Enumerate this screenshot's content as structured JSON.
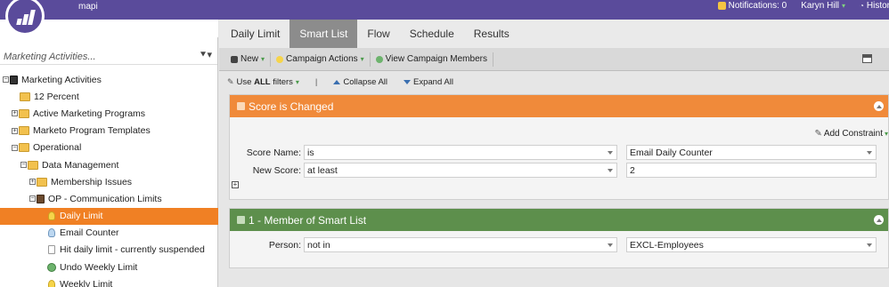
{
  "topbar": {
    "app_name": "mapi",
    "notifications": "Notifications: 0",
    "user": "Karyn Hill",
    "history": "History"
  },
  "sidebar": {
    "search_placeholder": "Marketing Activities...",
    "tree": [
      {
        "label": "Marketing Activities",
        "icon": "page-icon",
        "toggle": "-",
        "indent": 0
      },
      {
        "label": "12 Percent",
        "icon": "folder-icon",
        "toggle": "",
        "indent": 1
      },
      {
        "label": "Active Marketing Programs",
        "icon": "folder-icon",
        "toggle": "+",
        "indent": 1
      },
      {
        "label": "Marketo Program Templates",
        "icon": "folder-icon",
        "toggle": "+",
        "indent": 1
      },
      {
        "label": "Operational",
        "icon": "folder-icon",
        "toggle": "-",
        "indent": 1
      },
      {
        "label": "Data Management",
        "icon": "folder-icon",
        "toggle": "-",
        "indent": 2
      },
      {
        "label": "Membership Issues",
        "icon": "folder-icon",
        "toggle": "+",
        "indent": 3
      },
      {
        "label": "OP - Communication Limits",
        "icon": "program-icon",
        "toggle": "-",
        "indent": 3
      },
      {
        "label": "Daily Limit",
        "icon": "smart-list-icon",
        "toggle": "",
        "indent": 4,
        "selected": true
      },
      {
        "label": "Email Counter",
        "icon": "smart-list-icon-blue",
        "toggle": "",
        "indent": 4
      },
      {
        "label": "Hit daily limit - currently suspended",
        "icon": "doc-icon",
        "toggle": "",
        "indent": 4
      },
      {
        "label": "Undo Weekly Limit",
        "icon": "globe-icon",
        "toggle": "",
        "indent": 4
      },
      {
        "label": "Weekly Limit",
        "icon": "smart-list-icon",
        "toggle": "",
        "indent": 4
      }
    ]
  },
  "tabs": [
    "Daily Limit",
    "Smart List",
    "Flow",
    "Schedule",
    "Results"
  ],
  "active_tab": "Smart List",
  "toolbar": {
    "new_label": "New",
    "campaign_actions_label": "Campaign Actions",
    "view_members_label": "View Campaign Members"
  },
  "filterbar": {
    "use_all_prefix": "Use ",
    "use_all_bold": "ALL",
    "use_all_suffix": " filters",
    "separator": "|",
    "collapse_all": "Collapse All",
    "expand_all": "Expand All"
  },
  "trigger": {
    "title": "Score is Changed",
    "add_constraint": "Add Constraint",
    "rows": [
      {
        "label": "Score Name:",
        "operator": "is",
        "value": "Email Daily Counter",
        "value_is_select": true
      },
      {
        "label": "New Score:",
        "operator": "at least",
        "value": "2",
        "value_is_select": false
      }
    ]
  },
  "filter": {
    "title": "1 - Member of Smart List",
    "rows": [
      {
        "label": "Person:",
        "operator": "not in",
        "value": "EXCL-Employees",
        "value_is_select": true
      }
    ]
  },
  "colors": {
    "brand_purple": "#5a4b9b",
    "selected_orange": "#f08024",
    "trigger_orange": "#f08a3a",
    "filter_green": "#5d8f4c"
  }
}
